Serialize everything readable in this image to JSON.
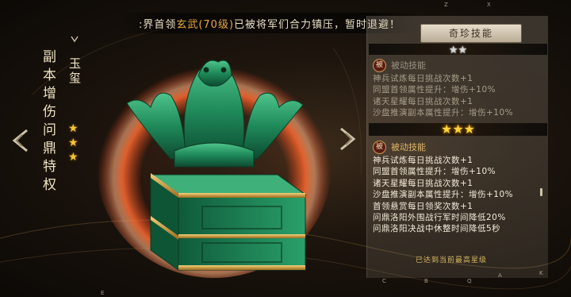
{
  "banner": {
    "prefix": ":界首领",
    "boss": "玄武(70级)",
    "suffix": "已被将军们合力镇压，暂时退避！"
  },
  "item": {
    "category": "副本增伤问鼎特权",
    "name": "玉玺",
    "star_count": 3
  },
  "panel": {
    "tab_label": "奇珍技能",
    "tier1": {
      "stars": "★★",
      "badge": "被",
      "title": "被动技能",
      "lines": [
        "神兵试炼每日挑战次数+1",
        "同盟首领属性提升：增伤+10%",
        "诸天星耀每日挑战次数+1",
        "沙盘推演副本属性提升：增伤+10%"
      ]
    },
    "tier2": {
      "stars": "★★★",
      "badge": "被",
      "title": "被动技能",
      "lines": [
        "神兵试炼每日挑战次数+1",
        "同盟首领属性提升：增伤+10%",
        "诸天星耀每日挑战次数+1",
        "沙盘推演副本属性提升：增伤+10%",
        "首领悬赏每日领奖次数+1",
        "问鼎洛阳外围战行军时间降低20%",
        "问鼎洛阳决战中休整时间降低5秒"
      ]
    },
    "footer": "已达到当前最高星级"
  },
  "key_hints": [
    "Z",
    "X",
    "C",
    "B",
    "Q",
    "A",
    "K",
    "E"
  ],
  "colors": {
    "gold": "#e7a93c",
    "jade": "#1f8a5a",
    "aura": "#ff5a2a"
  }
}
